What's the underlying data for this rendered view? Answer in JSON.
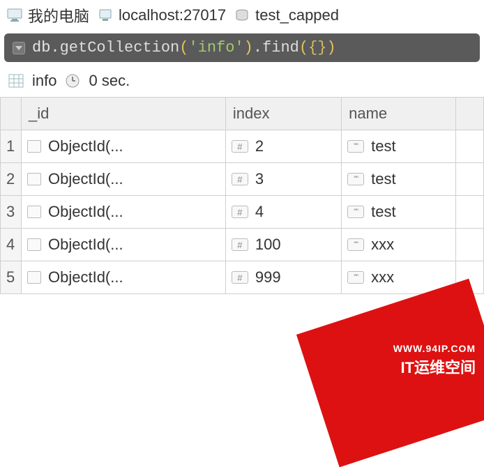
{
  "breadcrumb": {
    "computer": "我的电脑",
    "host": "localhost:27017",
    "database": "test_capped"
  },
  "query": {
    "db": "db",
    "method1": "getCollection",
    "arg1": "'info'",
    "method2": "find",
    "arg2_open": "{",
    "arg2_close": "}"
  },
  "infobar": {
    "collection": "info",
    "timing": "0 sec."
  },
  "columns": {
    "rownum": "",
    "id": "_id",
    "index": "index",
    "name": "name"
  },
  "rows": [
    {
      "n": "1",
      "id": "ObjectId(...",
      "index": "2",
      "name": "test"
    },
    {
      "n": "2",
      "id": "ObjectId(...",
      "index": "3",
      "name": "test"
    },
    {
      "n": "3",
      "id": "ObjectId(...",
      "index": "4",
      "name": "test"
    },
    {
      "n": "4",
      "id": "ObjectId(...",
      "index": "100",
      "name": "xxx"
    },
    {
      "n": "5",
      "id": "ObjectId(...",
      "index": "999",
      "name": "xxx"
    }
  ],
  "watermark": {
    "url": "WWW.94IP.COM",
    "title": "IT运维空间"
  },
  "icons": {
    "computer": "computer-icon",
    "server": "server-icon",
    "database": "database-icon",
    "grid": "grid-icon",
    "clock": "clock-icon",
    "dropdown": "dropdown-icon"
  }
}
